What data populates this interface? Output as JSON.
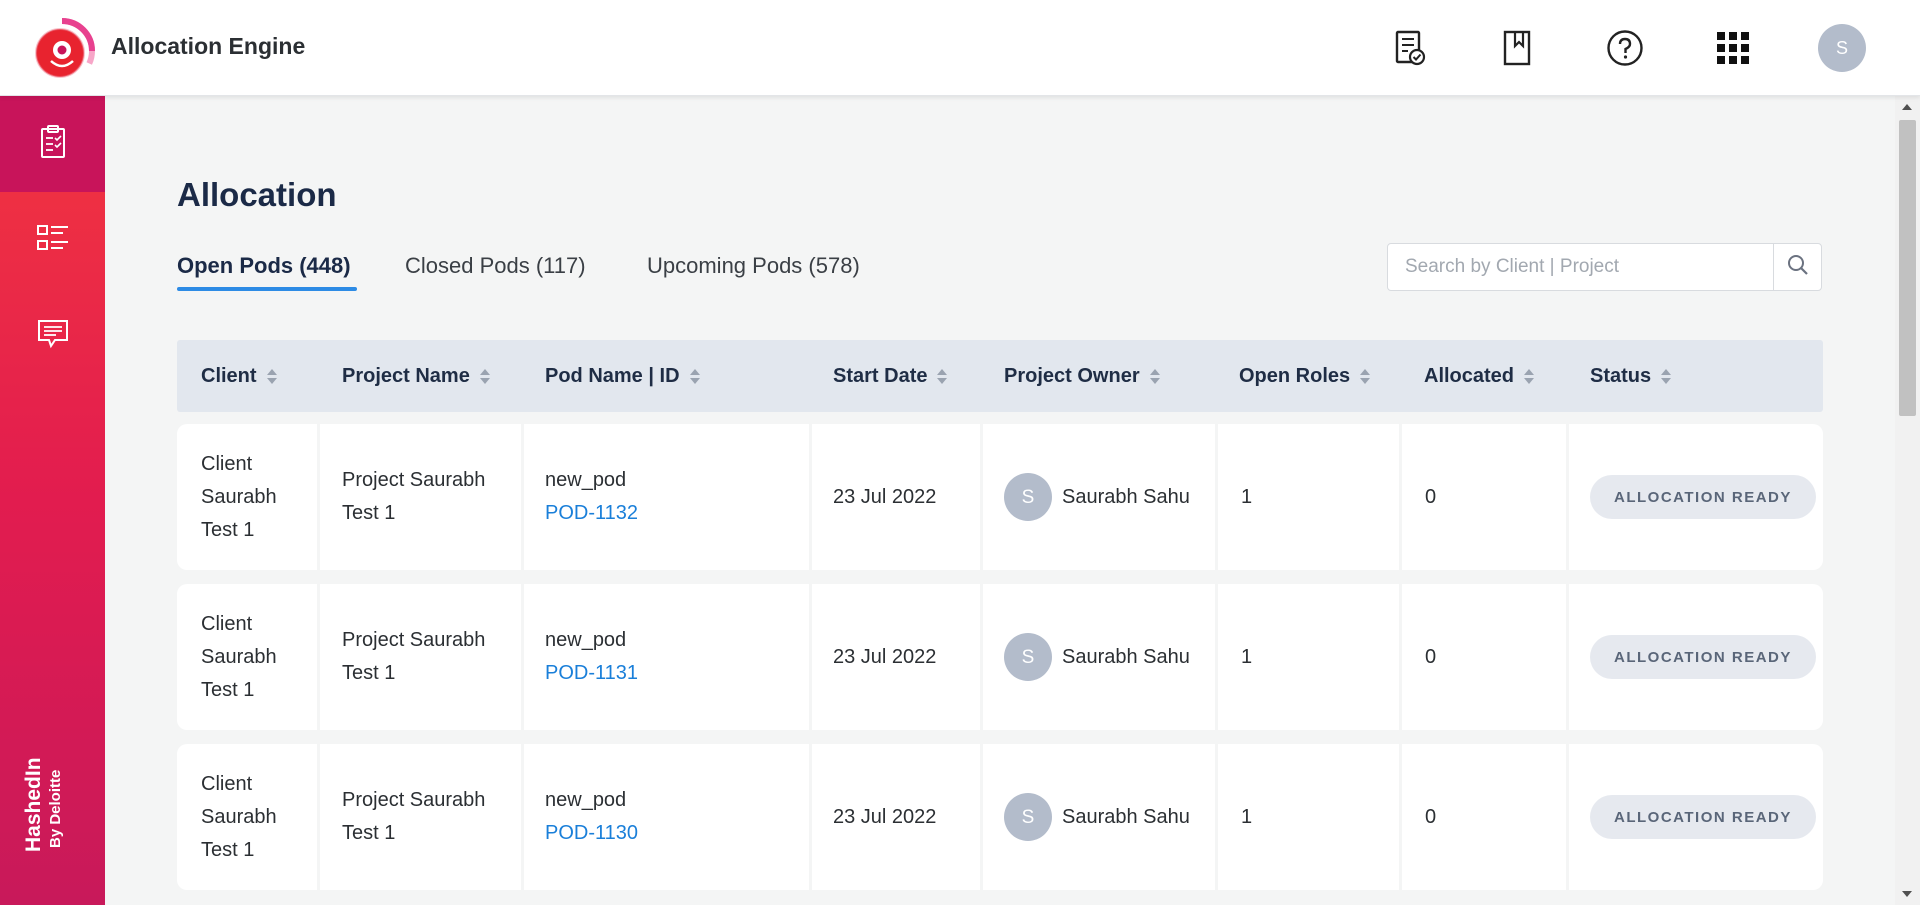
{
  "app": {
    "title": "Allocation Engine"
  },
  "header": {
    "icons": [
      "report-check-icon",
      "bookmark-icon",
      "help-icon",
      "apps-grid-icon"
    ],
    "user_initial": "S"
  },
  "sidebar": {
    "items": [
      {
        "icon": "clipboard-check-icon",
        "active": true
      },
      {
        "icon": "list-icon",
        "active": false
      },
      {
        "icon": "message-icon",
        "active": false
      }
    ],
    "brand": "HashedIn",
    "brand_sub": "By Deloitte"
  },
  "main": {
    "title": "Allocation",
    "tabs": [
      {
        "label": "Open Pods (448)",
        "active": true
      },
      {
        "label": "Closed Pods (117)",
        "active": false
      },
      {
        "label": "Upcoming Pods (578)",
        "active": false
      }
    ],
    "search": {
      "placeholder": "Search by Client | Project",
      "value": ""
    }
  },
  "table": {
    "columns": [
      "Client",
      "Project Name",
      "Pod Name | ID",
      "Start Date",
      "Project Owner",
      "Open Roles",
      "Allocated",
      "Status"
    ],
    "rows": [
      {
        "client_l1": "Client",
        "client_l2": "Saurabh",
        "client_l3": "Test 1",
        "project_l1": "Project Saurabh",
        "project_l2": "Test 1",
        "pod_name": "new_pod",
        "pod_id": "POD-1132",
        "start_date": "23 Jul 2022",
        "owner_initial": "S",
        "owner": "Saurabh Sahu",
        "open_roles": "1",
        "allocated": "0",
        "status": "ALLOCATION READY"
      },
      {
        "client_l1": "Client",
        "client_l2": "Saurabh",
        "client_l3": "Test 1",
        "project_l1": "Project Saurabh",
        "project_l2": "Test 1",
        "pod_name": "new_pod",
        "pod_id": "POD-1131",
        "start_date": "23 Jul 2022",
        "owner_initial": "S",
        "owner": "Saurabh Sahu",
        "open_roles": "1",
        "allocated": "0",
        "status": "ALLOCATION READY"
      },
      {
        "client_l1": "Client",
        "client_l2": "Saurabh",
        "client_l3": "Test 1",
        "project_l1": "Project Saurabh",
        "project_l2": "Test 1",
        "pod_name": "new_pod",
        "pod_id": "POD-1130",
        "start_date": "23 Jul 2022",
        "owner_initial": "S",
        "owner": "Saurabh Sahu",
        "open_roles": "1",
        "allocated": "0",
        "status": "ALLOCATION READY"
      }
    ]
  },
  "colors": {
    "accent": "#2d8be5",
    "link": "#1a7fd9",
    "sidebar_top": "#f2363f",
    "sidebar_bottom": "#c8195a"
  }
}
